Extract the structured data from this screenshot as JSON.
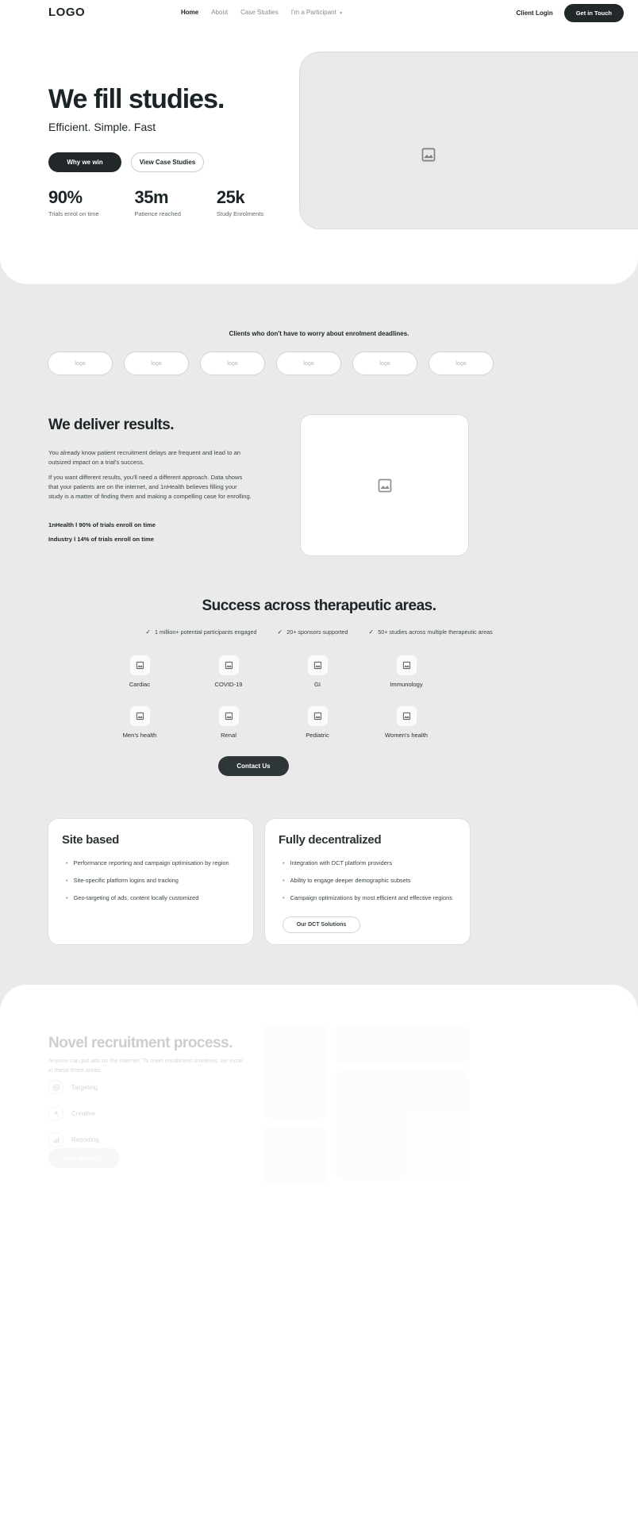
{
  "nav": {
    "logo": "LOGO",
    "links": [
      {
        "label": "Home",
        "active": true
      },
      {
        "label": "About",
        "active": false
      },
      {
        "label": "Case Studies",
        "active": false
      },
      {
        "label": "I'm a Participant",
        "active": false,
        "caret": "⌄"
      }
    ],
    "client_login": "Client Login",
    "cta": "Get in Touch"
  },
  "hero": {
    "title": "We fill studies.",
    "subtitle": "Efficient. Simple. Fast",
    "primary_button": "Why we win",
    "secondary_button": "View Case Studies",
    "stats": [
      {
        "value": "90%",
        "label": "Trials enrol on time"
      },
      {
        "value": "35m",
        "label": "Patience reached"
      },
      {
        "value": "25k",
        "label": "Study Enrolments"
      }
    ]
  },
  "clients": {
    "heading": "Clients who don't have to worry about enrolment deadlines.",
    "logos": [
      "logo",
      "logo",
      "logo",
      "logo",
      "logo",
      "logo"
    ]
  },
  "deliver": {
    "title": "We deliver results.",
    "paragraph1": "You already know patient recruitment delays are frequent and lead to an outsized impact on a trial's success.",
    "paragraph2": "If you want different results, you'll need a different approach. Data shows that your patients are on the internet, and 1nHealth believes filling your study is a matter of finding them and making a compelling case for enrolling.",
    "stat1": "1nHealth l 90% of trials enroll on time",
    "stat2": "Industry l 14% of trials enroll on time"
  },
  "success": {
    "title": "Success across therapeutic areas.",
    "checks": [
      "1 million+ potential participants engaged",
      "20+ sponsors supported",
      "50+ studies across multiple therapeutic areas"
    ],
    "areas": [
      "Cardiac",
      "COVID-19",
      "GI",
      "Immunology",
      "Men's health",
      "Renal",
      "Pediatric",
      "Women's health"
    ],
    "contact_button": "Contact Us"
  },
  "cards": [
    {
      "title": "Site based",
      "items": [
        "Performance reporting and campaign optimisation by region",
        "Site-specific platform logins and tracking",
        "Geo-targeting of ads, content locally customized"
      ],
      "button": null
    },
    {
      "title": "Fully decentralized",
      "items": [
        "Integration with DCT platform providers",
        "Ability to engage deeper demographic subsets",
        "Campaign optimizations by most efficient and effective regions"
      ],
      "button": "Our DCT Solutions"
    }
  ],
  "process": {
    "title": "Novel recruitment process.",
    "paragraph": "Anyone can put ads on the internet.\nTo meet enrollment timelines, we excel in these three areas.",
    "items": [
      {
        "label": "Targeting",
        "icon": "target-icon"
      },
      {
        "label": "Creative",
        "icon": "sparkles-icon"
      },
      {
        "label": "Reporting",
        "icon": "bar-chart-icon"
      }
    ],
    "button": "More About Us"
  },
  "colors": {
    "dark": "#22282a",
    "page_bg": "#eaeaea",
    "panel_bg": "#ffffff",
    "muted_text": "#868c8e"
  }
}
